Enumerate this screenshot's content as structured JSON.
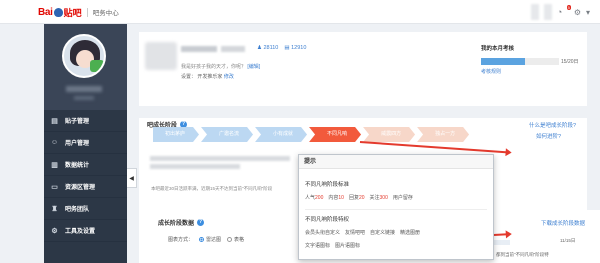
{
  "header": {
    "logo_text_a": "Bai",
    "logo_text_b": "du",
    "logo_text_c": "贴吧",
    "center_title": "吧务中心",
    "notification_count": "5",
    "accent_color": "#e10601"
  },
  "sidebar": {
    "items": [
      {
        "label": "贴子管理",
        "icon": "doc-icon"
      },
      {
        "label": "用户管理",
        "icon": "user-icon"
      },
      {
        "label": "数据统计",
        "icon": "stats-icon"
      },
      {
        "label": "资源区管理",
        "icon": "folder-icon"
      },
      {
        "label": "吧务团队",
        "icon": "team-icon"
      },
      {
        "label": "工具及设置",
        "icon": "gear-icon"
      }
    ]
  },
  "profile": {
    "stat_fans": "28110",
    "stat_posts": "12910",
    "intro_text": "我是好孩子我的天才，你呢？",
    "edit_label": "[编辑]",
    "tag_label": "设置：",
    "tag_value": "开发推乐家",
    "tag_link": "修改"
  },
  "exam": {
    "title": "我的本月考核",
    "value": "15/20日",
    "progress": 0.56,
    "link": "考核规则"
  },
  "stage": {
    "title": "吧成长阶段",
    "what_link": "什么是吧成长阶段?",
    "upgrade_link": "如何进阶?",
    "steps": [
      {
        "label": "初出茅庐",
        "state": "done"
      },
      {
        "label": "广邀名流",
        "state": "done"
      },
      {
        "label": "小有成就",
        "state": "done"
      },
      {
        "label": "不同凡响",
        "state": "active"
      },
      {
        "label": "威震四方",
        "state": "next"
      },
      {
        "label": "独占一方",
        "state": "next"
      }
    ],
    "note": "本吧最近30日活跃率满，近期15天不达到当前\"不同凡响\"阶段"
  },
  "popup": {
    "title": "提示",
    "section1_title": "不同凡响阶段标准",
    "criteria": [
      {
        "name": "人气",
        "value": "200"
      },
      {
        "name": "内容",
        "value": "10"
      },
      {
        "name": "回复",
        "value": "20"
      },
      {
        "name": "关注",
        "value": "300"
      }
    ],
    "criteria_tail": "用户留存",
    "section2_title": "不同凡响阶段特权",
    "perks_row1": [
      "会员头衔自定义",
      "友情吧吧",
      "自定义链接",
      "精选图册"
    ],
    "perks_row2": [
      "文字语图标",
      "图片语图标"
    ]
  },
  "growth": {
    "title": "成长阶段数据",
    "link": "下载成长阶段数据",
    "view_label": "图表方式：",
    "option_a": "雷达图",
    "option_b": "表格",
    "date": "11/15日",
    "side_note": "都到当前\"不同凡响\"阶段特"
  }
}
